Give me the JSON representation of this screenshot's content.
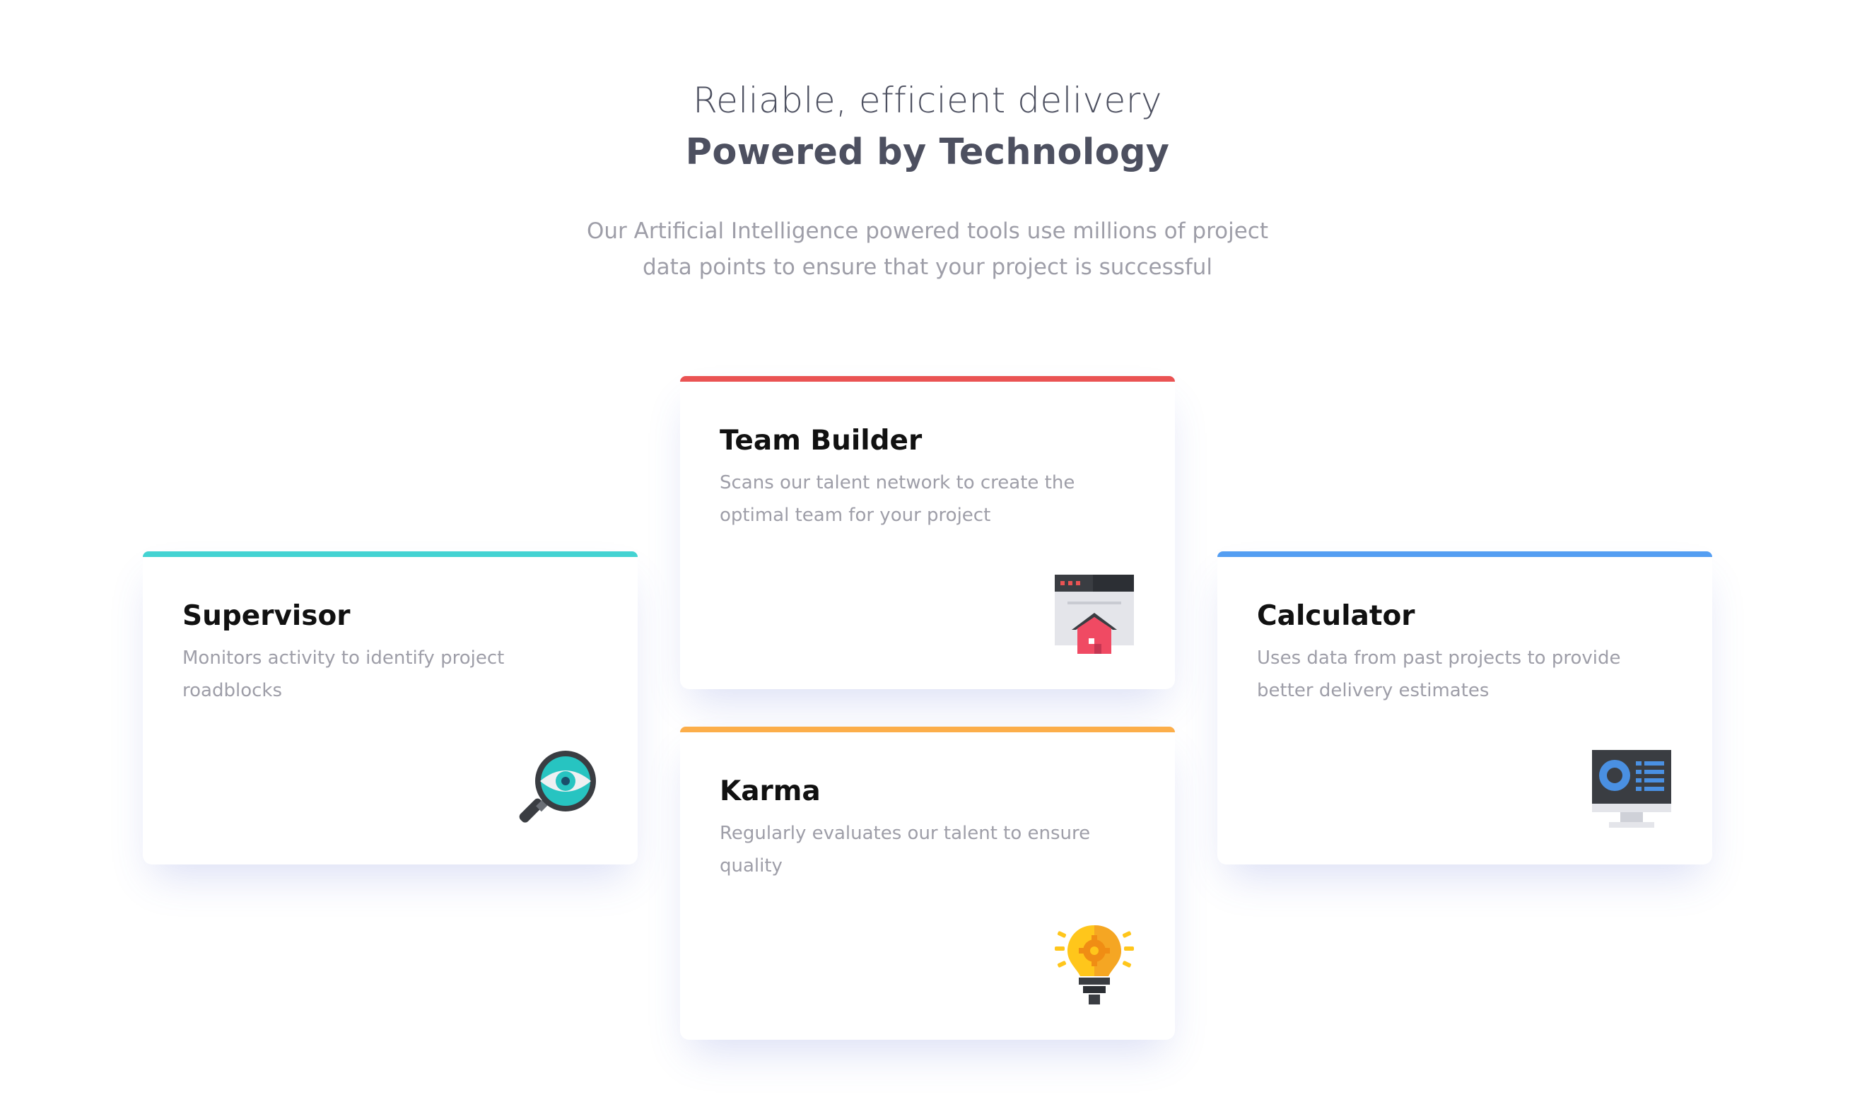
{
  "header": {
    "subtitle": "Reliable, efficient delivery",
    "title": "Powered by Technology",
    "description": "Our Artificial Intelligence powered tools use millions of project data points to ensure that your project is successful"
  },
  "cards": [
    {
      "title": "Supervisor",
      "text": "Monitors activity to identify project roadblocks",
      "accent": "#44d3d2",
      "icon": "magnifier-eye-icon"
    },
    {
      "title": "Team Builder",
      "text": "Scans our talent network to create the optimal team for your project",
      "accent": "#ea5353",
      "icon": "browser-house-icon"
    },
    {
      "title": "Karma",
      "text": "Regularly evaluates our talent to ensure quality",
      "accent": "#fcae4a",
      "icon": "lightbulb-gear-icon"
    },
    {
      "title": "Calculator",
      "text": "Uses data from past projects to provide better delivery estimates",
      "accent": "#549ef2",
      "icon": "monitor-chart-icon"
    }
  ]
}
